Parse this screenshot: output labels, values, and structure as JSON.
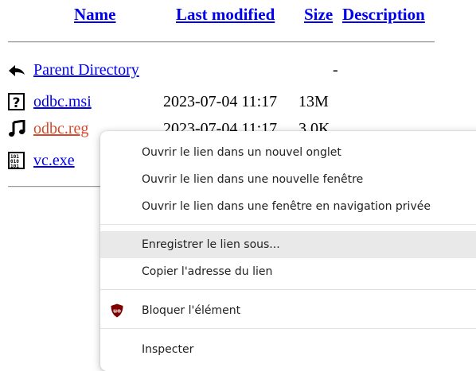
{
  "columns": {
    "name": "Name",
    "last_modified": "Last modified",
    "size": "Size",
    "description": "Description"
  },
  "files": [
    {
      "name": "Parent Directory",
      "date": "",
      "size": "-",
      "icon": "back-arrow-icon"
    },
    {
      "name": "odbc.msi",
      "date": "2023-07-04 11:17",
      "size": "13M",
      "icon": "unknown-file-icon"
    },
    {
      "name": "odbc.reg",
      "date": "2023-07-04 11:17",
      "size": "3.0K",
      "icon": "music-note-icon"
    },
    {
      "name": "vc.exe",
      "date": "",
      "size": "",
      "icon": "binary-file-icon"
    }
  ],
  "context_menu": {
    "open_new_tab": "Ouvrir le lien dans un nouvel onglet",
    "open_new_window": "Ouvrir le lien dans une nouvelle fenêtre",
    "open_private": "Ouvrir le lien dans une fenêtre en navigation privée",
    "save_link_as": "Enregistrer le lien sous...",
    "copy_link": "Copier l'adresse du lien",
    "block_element": "Bloquer l'élément",
    "inspect": "Inspecter"
  },
  "colors": {
    "link": "#0000ee",
    "visited_link": "#d44a2d",
    "menu_hover": "#e9e9e9",
    "ublock_red": "#800000"
  }
}
